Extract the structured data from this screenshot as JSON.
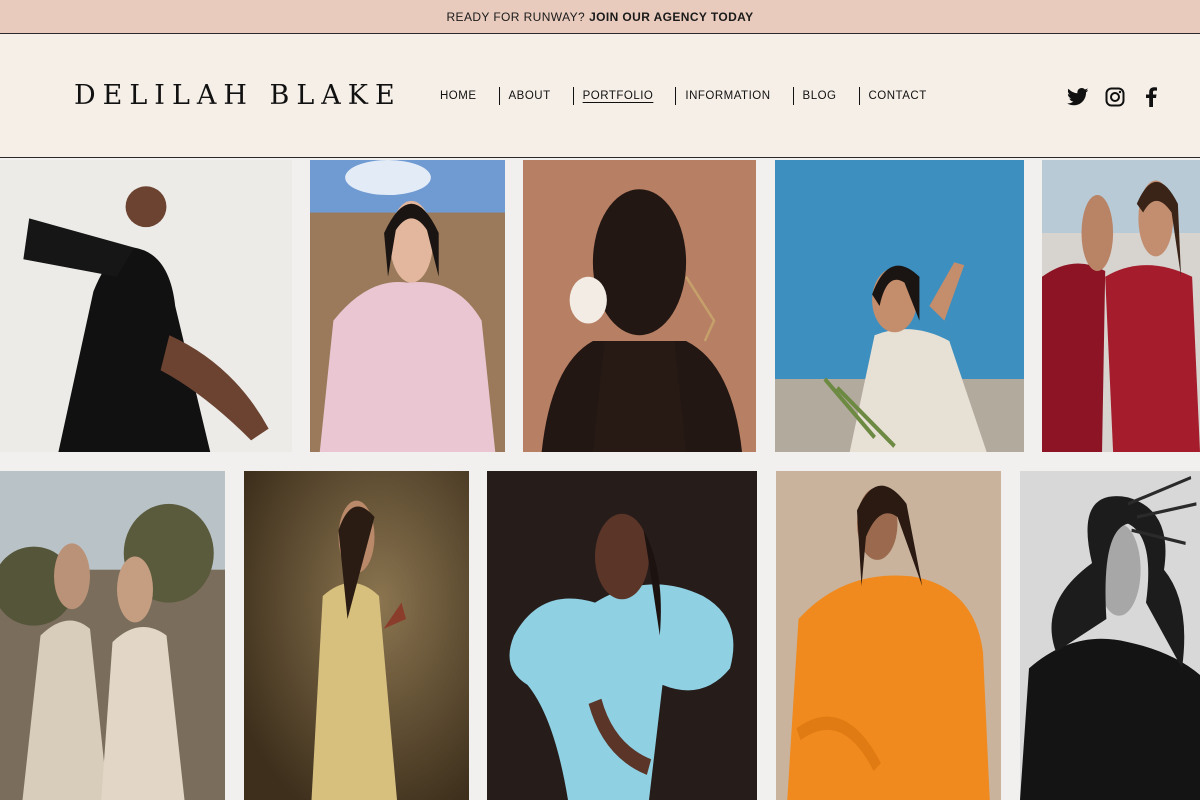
{
  "announcement": {
    "lead": "READY FOR RUNWAY?",
    "cta": "JOIN OUR AGENCY TODAY"
  },
  "brand": {
    "name": "DELILAH BLAKE"
  },
  "nav": {
    "items": [
      "HOME",
      "ABOUT",
      "PORTFOLIO",
      "INFORMATION",
      "BLOG",
      "CONTACT"
    ],
    "active": "PORTFOLIO"
  },
  "social": [
    "twitter-icon",
    "instagram-icon",
    "facebook-icon"
  ],
  "gallery": {
    "row1": [
      {
        "name": "photo-woman-black-dress",
        "bg": "#ecebe8",
        "accent": "#111111",
        "skin": "#6b4330"
      },
      {
        "name": "photo-woman-pink-dress-field",
        "bg": "#8ea9c8",
        "accent": "#e9c6d1",
        "skin": "#e3b79d"
      },
      {
        "name": "photo-portrait-peach-backdrop",
        "bg": "#b77f63",
        "accent": "#2a1c16",
        "skin": "#231714"
      },
      {
        "name": "photo-woman-blue-sky",
        "bg": "#3d8fbf",
        "accent": "#e7e0d5",
        "skin": "#c48d6c"
      },
      {
        "name": "photo-two-women-red-outfits",
        "bg": "#d7d3cf",
        "accent": "#8c1424",
        "skin": "#b98366"
      }
    ],
    "row2": [
      {
        "name": "photo-two-women-outdoors",
        "bg": "#7a6d5c",
        "accent": "#d8ccbb",
        "skin": "#b99277"
      },
      {
        "name": "photo-woman-yellow-suit",
        "bg": "#5c4a30",
        "accent": "#d7c07e",
        "skin": "#b9896a"
      },
      {
        "name": "photo-woman-blue-tulle",
        "bg": "#261c1a",
        "accent": "#8fd0e3",
        "skin": "#5b3528"
      },
      {
        "name": "photo-woman-orange-jacket",
        "bg": "#c9b39d",
        "accent": "#f08a1e",
        "skin": "#9b6a4e"
      },
      {
        "name": "photo-woman-black-white",
        "bg": "#d8d8d8",
        "accent": "#141414",
        "skin": "#a7a7a7"
      }
    ]
  },
  "colors": {
    "announcement_bg": "#e8cbbd",
    "header_bg": "#f5efe8",
    "page_bg": "#f2f0ee",
    "text": "#111111"
  }
}
